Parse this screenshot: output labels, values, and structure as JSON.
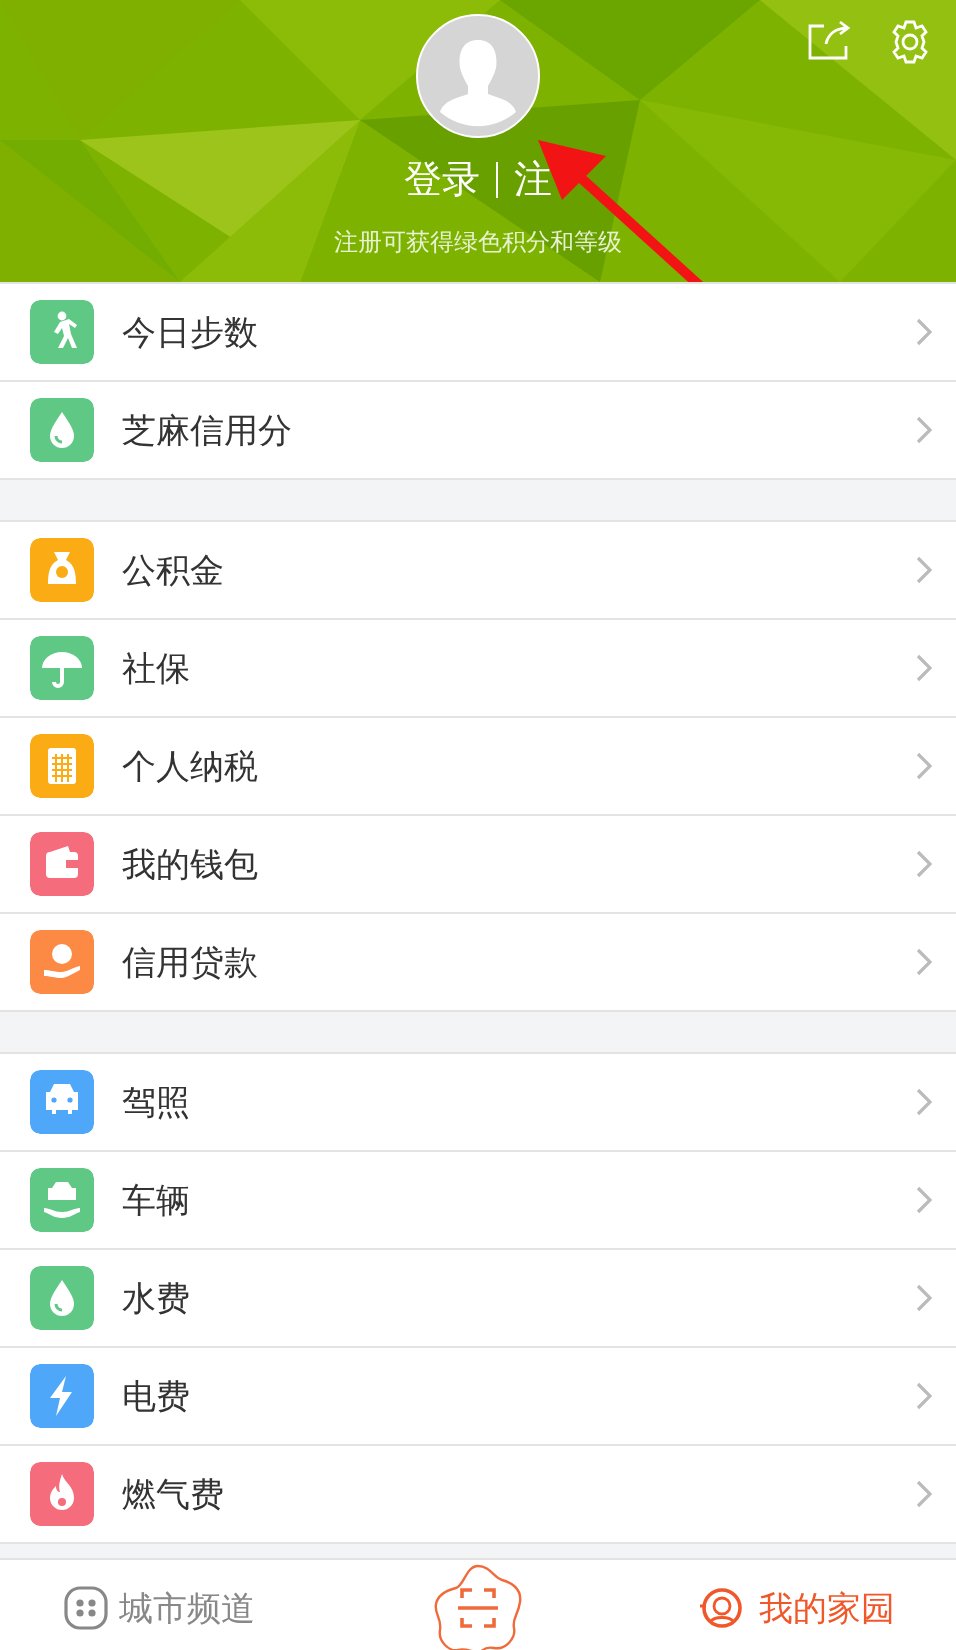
{
  "header": {
    "login": "登录",
    "register": "注",
    "hint": "注册可获得绿色积分和等级"
  },
  "groups": [
    {
      "items": [
        {
          "kind": "walk",
          "color": "#5ec884",
          "label": "今日步数"
        },
        {
          "kind": "drop",
          "color": "#5ec884",
          "label": "芝麻信用分"
        }
      ]
    },
    {
      "items": [
        {
          "kind": "moneybag",
          "color": "#fbab14",
          "label": "公积金"
        },
        {
          "kind": "umbrella",
          "color": "#5ec884",
          "label": "社保"
        },
        {
          "kind": "calculator",
          "color": "#fbab14",
          "label": "个人纳税"
        },
        {
          "kind": "wallet",
          "color": "#f56c7c",
          "label": "我的钱包"
        },
        {
          "kind": "loan",
          "color": "#fc8a45",
          "label": "信用贷款"
        }
      ]
    },
    {
      "items": [
        {
          "kind": "car",
          "color": "#4ea7f9",
          "label": "驾照"
        },
        {
          "kind": "carhand",
          "color": "#5ec884",
          "label": "车辆"
        },
        {
          "kind": "drop",
          "color": "#5ec884",
          "label": "水费"
        },
        {
          "kind": "bolt",
          "color": "#4ea7f9",
          "label": "电费"
        },
        {
          "kind": "flame",
          "color": "#f56c7c",
          "label": "燃气费"
        }
      ]
    }
  ],
  "tabbar": [
    {
      "kind": "channels",
      "label": "城市频道",
      "selected": false
    },
    {
      "kind": "scan"
    },
    {
      "kind": "home",
      "label": "我的家园",
      "selected": true
    }
  ]
}
